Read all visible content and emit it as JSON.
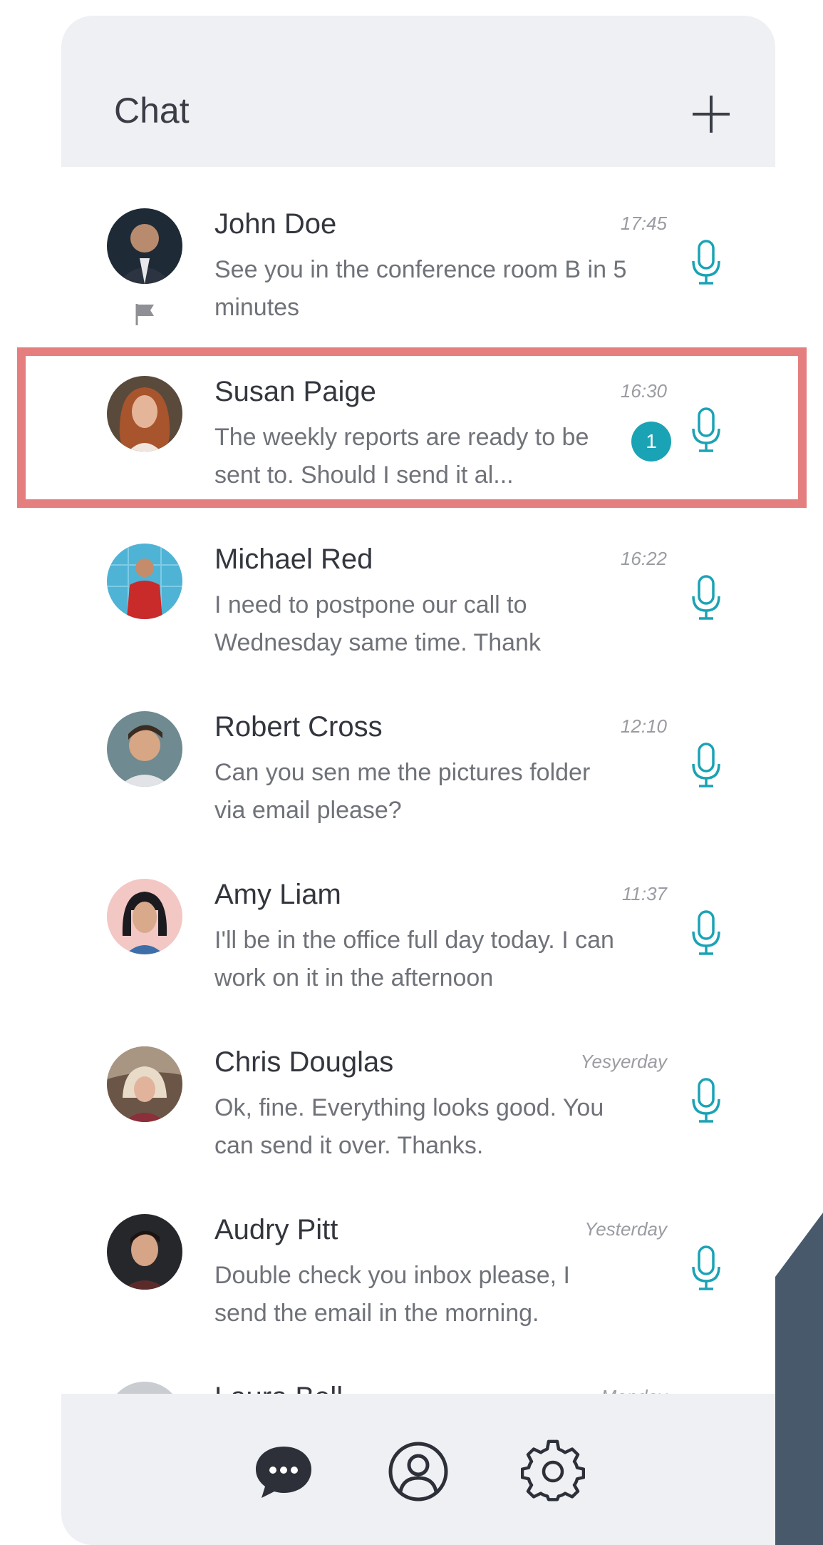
{
  "header": {
    "title": "Chat",
    "add_icon": "plus-icon"
  },
  "colors": {
    "accent": "#1aa3b5",
    "header_bg": "#eff0f4",
    "highlight": "#e57f7f",
    "dark_panel": "#47596b"
  },
  "chats": [
    {
      "name": "John Doe",
      "time": "17:45",
      "message": "See you in the conference room B in 5 minutes",
      "flagged": true,
      "unread": ""
    },
    {
      "name": "Susan Paige",
      "time": "16:30",
      "message": "The weekly reports are ready to be sent to. Should I send it al...",
      "flagged": false,
      "unread": "1"
    },
    {
      "name": "Michael Red",
      "time": "16:22",
      "message": "I need to postpone our call to Wednesday same time. Thank",
      "flagged": false,
      "unread": ""
    },
    {
      "name": "Robert Cross",
      "time": "12:10",
      "message": "Can you sen me the pictures folder via email please?",
      "flagged": false,
      "unread": ""
    },
    {
      "name": "Amy Liam",
      "time": "11:37",
      "message": "I'll be in the office full day today. I can work on it in the afternoon",
      "flagged": false,
      "unread": ""
    },
    {
      "name": "Chris Douglas",
      "time": "Yesyerday",
      "message": "Ok, fine. Everything looks good. You can send it over. Thanks.",
      "flagged": false,
      "unread": ""
    },
    {
      "name": "Audry Pitt",
      "time": "Yesterday",
      "message": "Double check you inbox please, I send the email in the morning.",
      "flagged": false,
      "unread": ""
    },
    {
      "name": "Laura Bell",
      "time": "Monday",
      "message": "",
      "flagged": false,
      "unread": ""
    }
  ],
  "tabbar": {
    "tabs": [
      {
        "icon": "chat-bubble-icon",
        "active": true
      },
      {
        "icon": "profile-icon",
        "active": false
      },
      {
        "icon": "gear-icon",
        "active": false
      }
    ]
  }
}
